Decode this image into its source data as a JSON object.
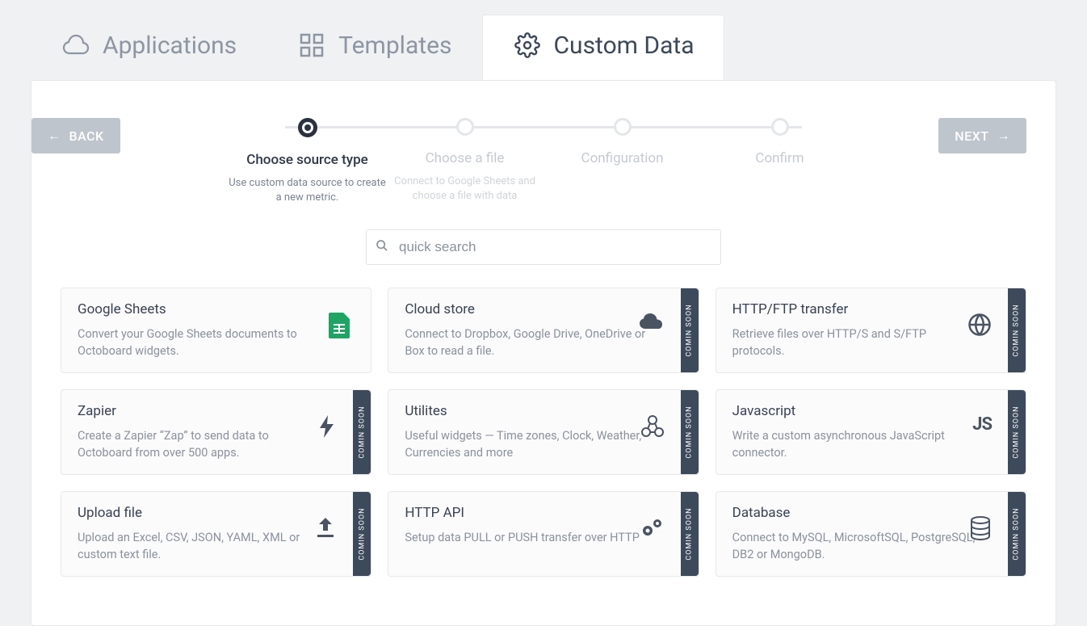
{
  "tabs": {
    "applications": "Applications",
    "templates": "Templates",
    "custom_data": "Custom Data"
  },
  "buttons": {
    "back": "BACK",
    "next": "NEXT"
  },
  "stepper": [
    {
      "title": "Choose source type",
      "desc": "Use custom data source to create a new metric."
    },
    {
      "title": "Choose a file",
      "desc": "Connect to Google Sheets and choose a file with data"
    },
    {
      "title": "Configuration",
      "desc": ""
    },
    {
      "title": "Confirm",
      "desc": ""
    }
  ],
  "search": {
    "placeholder": "quick search"
  },
  "badge_text": "COMIN SOON",
  "cards": [
    {
      "title": "Google Sheets",
      "desc": "Convert your Google Sheets documents to Octoboard widgets."
    },
    {
      "title": "Cloud store",
      "desc": "Connect to Dropbox, Google Drive, OneDrive or Box to read a file."
    },
    {
      "title": "HTTP/FTP transfer",
      "desc": "Retrieve files over HTTP/S and S/FTP protocols."
    },
    {
      "title": "Zapier",
      "desc": "Create a Zapier “Zap” to send data to Octoboard from over 500 apps."
    },
    {
      "title": "Utilites",
      "desc": "Useful widgets — Time zones, Clock, Weather, Currencies and more"
    },
    {
      "title": "Javascript",
      "desc": "Write a custom asynchronous JavaScript connector."
    },
    {
      "title": "Upload file",
      "desc": "Upload an Excel, CSV, JSON, YAML, XML or custom text file."
    },
    {
      "title": "HTTP API",
      "desc": "Setup data PULL or PUSH transfer over HTTP"
    },
    {
      "title": "Database",
      "desc": "Connect to MySQL, MicrosoftSQL, PostgreSQL, DB2 or MongoDB."
    }
  ]
}
